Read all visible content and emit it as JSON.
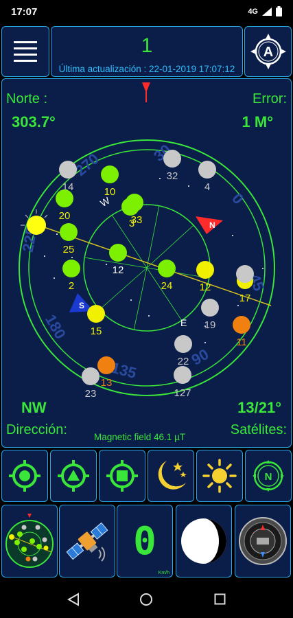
{
  "status_bar": {
    "time": "17:07",
    "network": "4G"
  },
  "header": {
    "satellite_count": "1",
    "last_update": "Última actualización : 22-01-2019 17:07:12"
  },
  "compass_info": {
    "north_label": "Norte :",
    "north_value": "303.7°",
    "error_label": "Error:",
    "error_value": "1 M°",
    "direction_value": "NW",
    "direction_label": "Dirección:",
    "satellites_value": "13/21°",
    "satellites_label": "Satélites:",
    "magnetic_field": "Magnetic field 46.1 µT"
  },
  "dial": {
    "cardinals": [
      "N",
      "S",
      "E",
      "W"
    ],
    "ring_numbers": [
      "30",
      "0",
      "270",
      "225",
      "180",
      "135",
      "90",
      "45"
    ]
  },
  "satellites": [
    {
      "id": "14",
      "color": "#c8c8c8",
      "label_color": "#c8c8c8"
    },
    {
      "id": "10",
      "color": "#7cf000",
      "label_color": "#f0f000"
    },
    {
      "id": "32",
      "color": "#c8c8c8",
      "label_color": "#c8c8c8"
    },
    {
      "id": "4",
      "color": "#c8c8c8",
      "label_color": "#c8c8c8"
    },
    {
      "id": "20",
      "color": "#7cf000",
      "label_color": "#f0f000"
    },
    {
      "id": "33",
      "color": "#7cf000",
      "label_color": "#f0f000"
    },
    {
      "id": "3",
      "color": "#7cf000",
      "label_color": "#f0f000"
    },
    {
      "id": "25",
      "color": "#7cf000",
      "label_color": "#f0f000"
    },
    {
      "id": "12",
      "color": "#7cf000",
      "label_color": "#ffffff"
    },
    {
      "id": "2",
      "color": "#7cf000",
      "label_color": "#f0f000"
    },
    {
      "id": "24",
      "color": "#7cf000",
      "label_color": "#f0f000"
    },
    {
      "id": "12",
      "color": "#f0f000",
      "label_color": "#f0f000"
    },
    {
      "id": "17",
      "color": "#c8c8c8",
      "label_color": "#f0f000"
    },
    {
      "id": "15",
      "color": "#f0f000",
      "label_color": "#f0f000"
    },
    {
      "id": "19",
      "color": "#c8c8c8",
      "label_color": "#c8c8c8"
    },
    {
      "id": "11",
      "color": "#f08010",
      "label_color": "#f08010"
    },
    {
      "id": "22",
      "color": "#c8c8c8",
      "label_color": "#c8c8c8"
    },
    {
      "id": "13",
      "color": "#f08010",
      "label_color": "#f08010"
    },
    {
      "id": "23",
      "color": "#c8c8c8",
      "label_color": "#c8c8c8"
    },
    {
      "id": "127",
      "color": "#c8c8c8",
      "label_color": "#c8c8c8"
    }
  ],
  "sun_marker": "sun",
  "speed_display": {
    "value": "0",
    "unit": "Km/h"
  },
  "icons": {
    "menu": "menu-icon",
    "compass_logo": "compass-a-icon",
    "gps_circle": "crosshair-circle-icon",
    "gps_triangle": "crosshair-triangle-icon",
    "gps_square": "crosshair-square-icon",
    "moon_stars": "moon-stars-icon",
    "sun": "sun-icon",
    "north_compass": "north-compass-icon",
    "radar_thumb": "radar-thumbnail-icon",
    "satellite": "satellite-icon",
    "moon_phase": "moon-phase-icon",
    "watch_compass": "watch-compass-icon"
  },
  "colors": {
    "accent_green": "#39e639",
    "panel": "#0b1e4a",
    "border": "#2aa8e6",
    "cyan_text": "#2fc0ff"
  }
}
